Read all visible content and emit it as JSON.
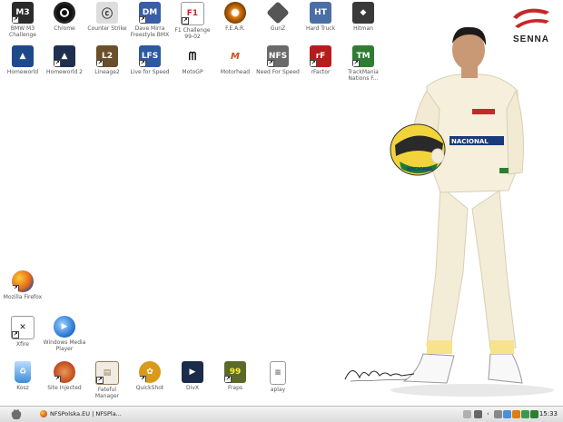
{
  "desktop": {
    "icons": [
      {
        "label": "BMW M3 Challenge",
        "icon": "bmw-m3-icon",
        "color": "#2b2b2b"
      },
      {
        "label": "Chrome",
        "icon": "chrome-icon",
        "color": "#222222"
      },
      {
        "label": "Counter Strike",
        "icon": "counter-strike-icon",
        "color": "#7a7a7a"
      },
      {
        "label": "Dave Mirra Freestyle BMX",
        "icon": "dave-mirra-icon",
        "color": "#3a5da8"
      },
      {
        "label": "F1 Challenge 99-02",
        "icon": "f1-challenge-icon",
        "color": "#c62828"
      },
      {
        "label": "F.E.A.R.",
        "icon": "fear-icon",
        "color": "#e07b10"
      },
      {
        "label": "GunZ",
        "icon": "gunz-icon",
        "color": "#555555"
      },
      {
        "label": "Hard Truck",
        "icon": "hard-truck-icon",
        "color": "#4a6fa5"
      },
      {
        "label": "Hitman",
        "icon": "hitman-icon",
        "color": "#3a3a3a"
      },
      {
        "label": "Homeworld",
        "icon": "homeworld-icon",
        "color": "#1e4a8a"
      },
      {
        "label": "Homeworld 2",
        "icon": "homeworld-2-icon",
        "color": "#1f2f4f"
      },
      {
        "label": "Lineage2",
        "icon": "lineage2-icon",
        "color": "#6b4f2a"
      },
      {
        "label": "Live for Speed",
        "icon": "live-for-speed-icon",
        "color": "#2c5aa0"
      },
      {
        "label": "MotoGP",
        "icon": "motogp-icon",
        "color": "#1a1a1a"
      },
      {
        "label": "Motorhead",
        "icon": "motorhead-icon",
        "color": "#d64a12"
      },
      {
        "label": "Need For Speed",
        "icon": "need-for-speed-icon",
        "color": "#6a6a6a"
      },
      {
        "label": "rFactor",
        "icon": "rfactor-icon",
        "color": "#b71c1c"
      },
      {
        "label": "TrackMania Nations F...",
        "icon": "trackmania-icon",
        "color": "#2e7d32"
      },
      {
        "label": "Mozilla Firefox",
        "icon": "firefox-icon",
        "color": "#e0651b"
      },
      {
        "label": "Xfire",
        "icon": "xfire-icon",
        "color": "#2a2a2a"
      },
      {
        "label": "Windows Media Player",
        "icon": "media-player-icon",
        "color": "#1f6fd0"
      },
      {
        "label": "Kosz",
        "icon": "recycle-bin-icon",
        "color": "#3d8ed8"
      },
      {
        "label": "Site Injected",
        "icon": "site-injected-icon",
        "color": "#c2461a"
      },
      {
        "label": "Fateful Manager",
        "icon": "fateful-manager-icon",
        "color": "#9a7b5a"
      },
      {
        "label": "QuickShot",
        "icon": "quickshot-icon",
        "color": "#d99a1b"
      },
      {
        "label": "DivX",
        "icon": "divx-icon",
        "color": "#1b2b4a"
      },
      {
        "label": "Fraps",
        "icon": "fraps-icon",
        "color": "#5a6a2a"
      },
      {
        "label": "aplay",
        "icon": "aplay-icon",
        "color": "#e8e8e8"
      }
    ]
  },
  "wallpaper": {
    "logo_text": "SENNA",
    "helmet_text": "NACIONAL",
    "signature_text": "Ayrton Senna"
  },
  "taskbar": {
    "task_label": "NFSPolska.EU | NFSPla...",
    "clock": "15:33",
    "colors": {
      "background": "#e6e6e6",
      "accent": "#c62828"
    }
  }
}
